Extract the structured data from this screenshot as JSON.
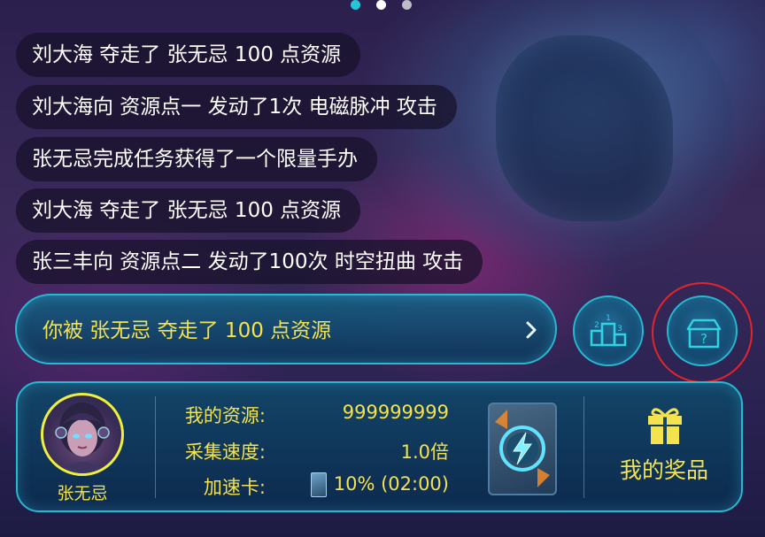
{
  "carousel": {
    "pages": 3,
    "active": 1
  },
  "messages": [
    "刘大海 夺走了 张无忌 100 点资源",
    "刘大海向 资源点一 发动了1次 电磁脉冲 攻击",
    "张无忌完成任务获得了一个限量手办",
    "刘大海 夺走了 张无忌 100 点资源",
    "张三丰向 资源点二 发动了100次 时空扭曲 攻击"
  ],
  "notification": {
    "text": "你被 张无忌 夺走了 100 点资源"
  },
  "buttons": {
    "ranking_icon": "podium-icon",
    "mystery_box_icon": "mystery-box-icon",
    "ranking_numbers": [
      "2",
      "1",
      "3"
    ],
    "mystery_box_symbol": "?"
  },
  "player": {
    "name": "张无忌",
    "resources_label": "我的资源:",
    "resources_value": "999999999",
    "speed_label": "采集速度:",
    "speed_value": "1.0倍",
    "boost_label": "加速卡:",
    "boost_value": "10% (02:00)"
  },
  "prizes": {
    "label": "我的奖品",
    "icon": "gift-icon"
  },
  "colors": {
    "accent": "#27b8d2",
    "text_yellow": "#f4e24f",
    "highlight_ring": "#e3252b",
    "active_dot": "#25c6d6"
  }
}
